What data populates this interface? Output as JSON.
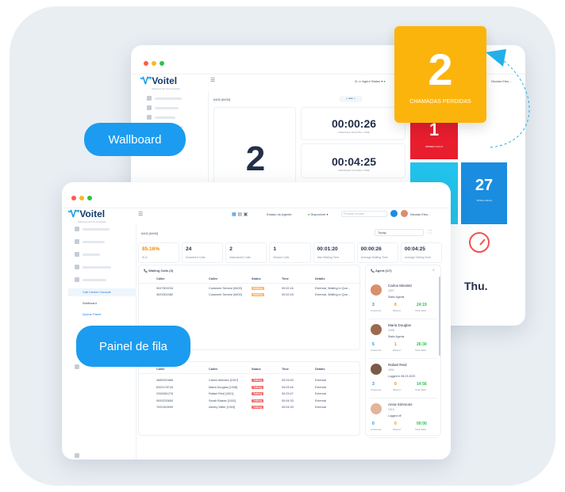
{
  "back_window": {
    "logo": "Voitel",
    "logo_sub": "Solucoes de Comunicacao",
    "topbar": {
      "agent_status": "Agent Status",
      "user": "Nicolas Eleu..."
    },
    "queue_select": "6400 [6400]",
    "sidebar_item": "Call Center Console",
    "sidebar_sub": "Wallboard",
    "big_number": "2",
    "avg_wait_value": "00:00:26",
    "avg_wait_label": "AVERAGE WAITING TIME",
    "avg_talk_value": "00:04:25",
    "avg_talk_label": "AVERAGE TALKING TIME",
    "missed_value": "1",
    "missed_label": "MISSED CALLS",
    "total_value": "27",
    "total_label": "TOTAL CALLS",
    "day": "Thu."
  },
  "callout": {
    "value": "2",
    "label": "CHAMADAS PERDIDAS"
  },
  "pills": {
    "wallboard": "Wallboard",
    "queue_panel": "Painel de fila"
  },
  "front_window": {
    "logo": "Voitel",
    "logo_sub": "Solucoes de Comunicacao",
    "topbar": {
      "estado": "Estado do Agente",
      "disponivel": "Disponível",
      "search_placeholder": "Procurar na lista",
      "user": "Nicolas Eleu..."
    },
    "queue_select": "6400 [6400]",
    "range_select": "Today",
    "sidebar": {
      "item": "Call Center Console",
      "sub1": "Wallboard",
      "sub2": "Queue Panel"
    },
    "stats": [
      {
        "value": "85.16%",
        "label": "SLA",
        "accent": true
      },
      {
        "value": "24",
        "label": "Answered Calls"
      },
      {
        "value": "2",
        "label": "Abandoned Calls"
      },
      {
        "value": "1",
        "label": "Missed Calls"
      },
      {
        "value": "00:01:20",
        "label": "Max Waiting Time"
      },
      {
        "value": "00:00:26",
        "label": "Average Waiting Time"
      },
      {
        "value": "00:04:25",
        "label": "Average Talking Time"
      }
    ],
    "waiting": {
      "title": "Waiting Calls (3)",
      "headers": [
        "Caller",
        "Callee",
        "Status",
        "Time",
        "Details"
      ],
      "rows": [
        [
          "9047502234",
          "Customer Service [6400]",
          "Waiting",
          "00:02:16",
          "External, Waiting in Que..."
        ],
        [
          "3029302482",
          "Customer Service [6400]",
          "Waiting",
          "00:02:18",
          "External, Waiting in Que..."
        ]
      ]
    },
    "talking": {
      "headers": [
        "Caller",
        "Callee",
        "Status",
        "Time",
        "Details"
      ],
      "rows": [
        [
          "4689021866",
          "Carlos Mendez [1007]",
          "Talking",
          "00:03:49",
          "External"
        ],
        [
          "6202176744",
          "Maria Douglas [1008]",
          "Talking",
          "00:03:16",
          "External"
        ],
        [
          "2349081278",
          "Rafael Reid [1001]",
          "Talking",
          "00:23:47",
          "External"
        ],
        [
          "9093233650",
          "Sarah Blasse [1002]",
          "Talking",
          "00:04:33",
          "External"
        ],
        [
          "7020343909",
          "Ashley Miller [1003]",
          "Talking",
          "00:04:33",
          "External"
        ]
      ]
    },
    "agents": {
      "title": "Agent (1/7)",
      "list": [
        {
          "name": "Carlos Mendez",
          "ext": "1007",
          "queue": "Static Agents",
          "answered": "3",
          "missed": "0",
          "talk": "24:19"
        },
        {
          "name": "Maria Douglas",
          "ext": "1008",
          "queue": "Static Agents",
          "answered": "5",
          "missed": "1",
          "talk": "26:30"
        },
        {
          "name": "Rafael Reid",
          "ext": "1001",
          "queue": "Logged in 08-23-2023",
          "answered": "3",
          "missed": "0",
          "talk": "14:56"
        },
        {
          "name": "Anna Simmons",
          "ext": "1010",
          "queue": "Logged off",
          "answered": "0",
          "missed": "0",
          "talk": "00:00"
        }
      ],
      "labels": {
        "answered": "Answered",
        "missed": "Missed",
        "talk": "Total Talks"
      }
    }
  }
}
